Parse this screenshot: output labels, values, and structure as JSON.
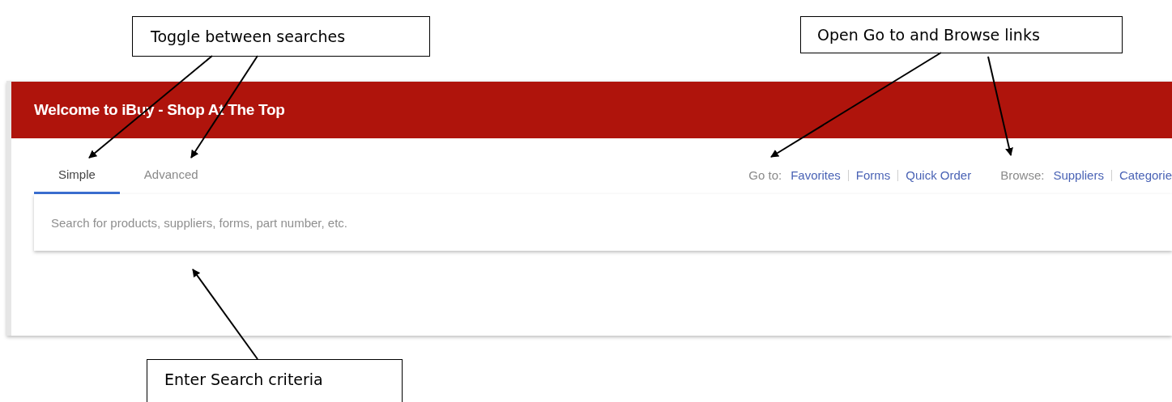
{
  "callouts": [
    {
      "text": "Toggle between searches"
    },
    {
      "text": "Open Go to and Browse links"
    },
    {
      "text": "Enter Search criteria"
    }
  ],
  "header": {
    "title": "Welcome to iBuy - Shop At The Top"
  },
  "tabs": [
    {
      "label": "Simple",
      "selected": true
    },
    {
      "label": "Advanced",
      "selected": false
    }
  ],
  "goto": {
    "label": "Go to:",
    "links": [
      "Favorites",
      "Forms",
      "Quick Order"
    ]
  },
  "browse": {
    "label": "Browse:",
    "links": [
      "Suppliers",
      "Categorie"
    ]
  },
  "search": {
    "placeholder": "Search for products, suppliers, forms, part number, etc."
  }
}
